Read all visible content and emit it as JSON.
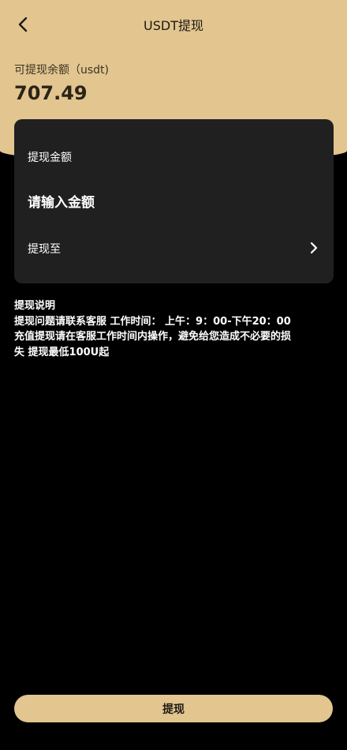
{
  "nav": {
    "title": "USDT提现"
  },
  "balance": {
    "label": "可提现余额（usdt)",
    "value": "707.49"
  },
  "form": {
    "amount_label": "提现金额",
    "amount_placeholder": "请输入金额",
    "amount_value": "",
    "withdraw_to_label": "提现至"
  },
  "notes": {
    "title": "提现说明",
    "lines": [
      "提现问题请联系客服 工作时间： 上午：9：00-下午20：00",
      "充值提现请在客服工作时间内操作，避免给您造成不必要的损",
      "失 提现最低100U起"
    ]
  },
  "submit": {
    "label": "提现"
  },
  "colors": {
    "accent": "#e2c58f",
    "card": "#202020",
    "background": "#000000"
  },
  "icons": {
    "back": "chevron-left-icon",
    "withdraw_to": "chevron-right-icon"
  }
}
